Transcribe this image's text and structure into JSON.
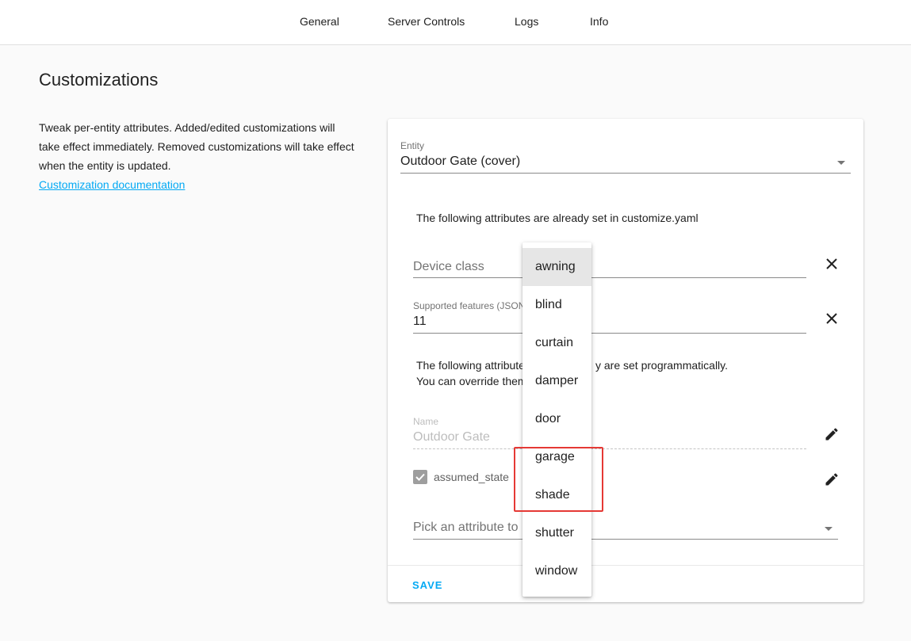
{
  "tabs": [
    {
      "label": "General"
    },
    {
      "label": "Server Controls"
    },
    {
      "label": "Logs"
    },
    {
      "label": "Info"
    }
  ],
  "page": {
    "title": "Customizations",
    "intro_text": "Tweak per-entity attributes. Added/edited customizations will take effect immediately. Removed customizations will take effect when the entity is updated.",
    "doc_link": "Customization documentation"
  },
  "entity": {
    "label": "Entity",
    "value": "Outdoor Gate (cover)"
  },
  "yaml_note": "The following attributes are already set in customize.yaml",
  "device_class": {
    "placeholder": "Device class"
  },
  "supported_features": {
    "label": "Supported features (JSON",
    "value": "11"
  },
  "programmatic_note": {
    "line1_prefix": "The following attribute",
    "line1_suffix": "y are set programmatically.",
    "line2_prefix": "You can override them"
  },
  "name_field": {
    "label": "Name",
    "value": "Outdoor Gate"
  },
  "assumed_state": {
    "label": "assumed_state",
    "checked": true
  },
  "pick_attribute": {
    "placeholder_prefix": "Pick an attribute to"
  },
  "actions": {
    "save": "SAVE"
  },
  "dropdown": {
    "options": [
      "awning",
      "blind",
      "curtain",
      "damper",
      "door",
      "garage",
      "shade",
      "shutter",
      "window"
    ],
    "selected": "awning",
    "highlighted": [
      "garage",
      "shade"
    ]
  },
  "colors": {
    "accent": "#03a9f4",
    "highlight": "#e53935",
    "background": "#fafafa"
  }
}
